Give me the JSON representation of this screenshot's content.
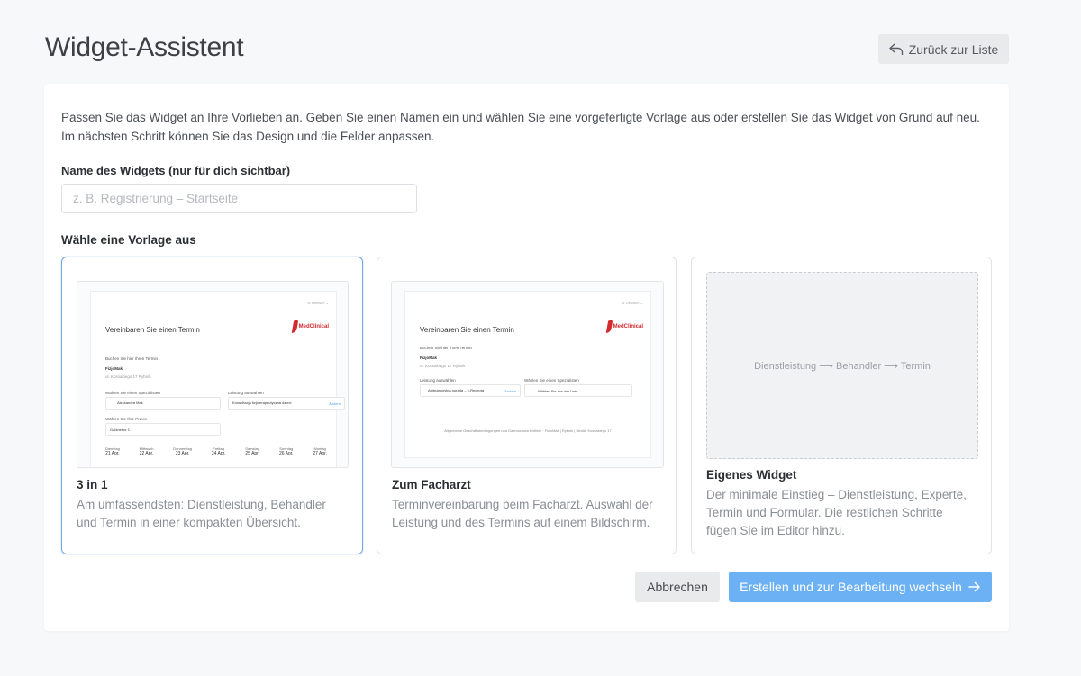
{
  "header": {
    "title": "Widget-Assistent",
    "back_label": "Zurück zur Liste",
    "back_icon": "reply-arrow-icon"
  },
  "form": {
    "intro": "Passen Sie das Widget an Ihre Vorlieben an. Geben Sie einen Namen ein und wählen Sie eine vorgefertigte Vorlage aus oder erstellen Sie das Widget von Grund auf neu. Im nächsten Schritt können Sie das Design und die Felder anpassen.",
    "name_label": "Name des Widgets (nur für dich sichtbar)",
    "name_value": "",
    "name_placeholder": "z. B. Registrierung – Startseite",
    "template_label": "Wähle eine Vorlage aus"
  },
  "templates": [
    {
      "title": "3 in 1",
      "description": "Am umfassendsten: Dienstleistung, Behandler und Termin in einer kompakten Übersicht.",
      "selected": true,
      "preview": {
        "lang": "⚙ Deutsch ⌄",
        "heading": "Vereinbaren Sie einen Termin",
        "logo": "MedClinical",
        "subheading": "Buchen Sie hier Ihren Termin",
        "clinic": "FizjoMak",
        "address": "ul. Kossakiego 17 Rybnik",
        "specialist_label": "Wählen Sie einen Spezialisten",
        "specialist_value": "Aleksandra Mak",
        "service_label": "Leistung auswählen",
        "service_value": "Konsultacja fizjoterapeutyczna dzieci",
        "service_action": "Ändern",
        "practice_label": "Wählen Sie Ihre Praxis",
        "practice_value": "Gabinet nr 1",
        "days": [
          {
            "name": "Dienstag",
            "date": "21 Apr."
          },
          {
            "name": "Mittwoch",
            "date": "22 Apr."
          },
          {
            "name": "Donnerstag",
            "date": "23 Apr."
          },
          {
            "name": "Freitag",
            "date": "24 Apr."
          },
          {
            "name": "Samstag",
            "date": "25 Apr."
          },
          {
            "name": "Sonntag",
            "date": "26 Apr."
          },
          {
            "name": "Montag",
            "date": "27 Apr."
          }
        ]
      }
    },
    {
      "title": "Zum Facharzt",
      "description": "Terminvereinbarung beim Facharzt. Auswahl der Leistung und des Termins auf einem Bildschirm.",
      "selected": false,
      "preview": {
        "lang": "⚙ Deutsch ⌄",
        "heading": "Vereinbaren Sie einen Termin",
        "logo": "MedClinical",
        "subheading": "Buchen Sie hier Ihren Termin",
        "clinic": "FizjoMak",
        "address": "ul. Kossakiego 17 Rybnik",
        "service_label": "Leistung auswählen",
        "service_value": "Ambulatoryjna porada – e-Recepta",
        "service_action": "Ändern",
        "specialist_label": "Wählen Sie einen Spezialisten",
        "specialist_value": "Wählen Sie aus der Liste",
        "footer": "Allgemeine Geschäftsbedingungen und Datenschutzrichtlinie · FizjoMak | Rybnik | Straße Kossakiego 17"
      }
    },
    {
      "title": "Eigenes Widget",
      "description": "Der minimale Einstieg – Dienstleistung, Experte, Termin und Formular. Die restlichen Schritte fügen Sie im Editor hinzu.",
      "selected": false,
      "flow": "Dienstleistung ⟶ Behandler ⟶ Termin"
    }
  ],
  "actions": {
    "cancel_label": "Abbrechen",
    "create_label": "Erstellen und zur Bearbeitung wechseln",
    "create_icon": "arrow-right-icon"
  },
  "colors": {
    "primary": "#6cb1f3",
    "selected_border": "#6ea8ea",
    "logo_red": "#d12a2f"
  }
}
